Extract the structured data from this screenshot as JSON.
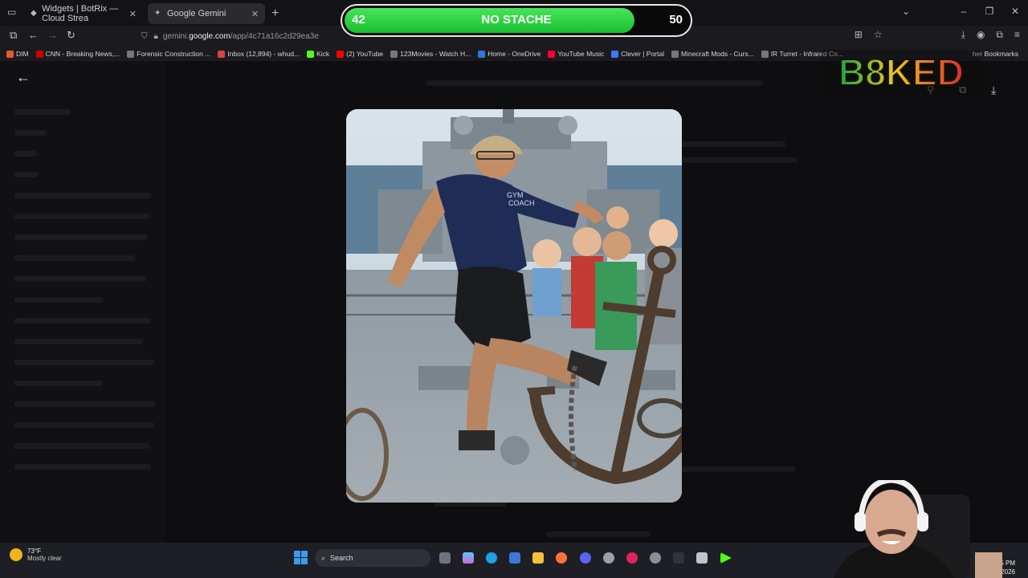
{
  "browser": {
    "tabs": [
      {
        "label": "Widgets | BotRix — Cloud Strea",
        "active": false
      },
      {
        "label": "Google Gemini",
        "active": true
      }
    ],
    "url_prefix": "gemini.",
    "url_domain": "google.com",
    "url_path": "/app/4c71a16c2d29ea3e",
    "bookmarks": [
      {
        "label": "DIM",
        "icon": "flame-icon",
        "color": "#e35a2a"
      },
      {
        "label": "CNN - Breaking News,...",
        "icon": "cnn-icon",
        "color": "#cc0000"
      },
      {
        "label": "Forensic Construction ...",
        "icon": "globe-icon",
        "color": "#777777"
      },
      {
        "label": "Inbox (12,894) - whud...",
        "icon": "mail-icon",
        "color": "#d44638"
      },
      {
        "label": "Kick",
        "icon": "kick-icon",
        "color": "#53fc18"
      },
      {
        "label": "(2) YouTube",
        "icon": "youtube-icon",
        "color": "#ff0000"
      },
      {
        "label": "123Movies - Watch H...",
        "icon": "globe-icon",
        "color": "#777777"
      },
      {
        "label": "Home - OneDrive",
        "icon": "onedrive-icon",
        "color": "#2b7cd3"
      },
      {
        "label": "YouTube Music",
        "icon": "music-icon",
        "color": "#ff0033"
      },
      {
        "label": "Clever | Portal",
        "icon": "clever-icon",
        "color": "#4274f6"
      },
      {
        "label": "Minecraft Mods - Curs...",
        "icon": "globe-icon",
        "color": "#777777"
      },
      {
        "label": "IR Turret - Infrared Co...",
        "icon": "globe-icon",
        "color": "#777777"
      }
    ],
    "other_bookmarks": "her Bookmarks"
  },
  "overlay": {
    "left_value": "42",
    "label": "NO STACHE",
    "right_value": "50",
    "progress": 0.84,
    "logo_text": "B8KED"
  },
  "taskbar": {
    "weather_temp": "73°F",
    "weather_desc": "Mostly clear",
    "search_label": "Search",
    "time": "9:25 PM",
    "date": "2/28/2026"
  },
  "image_viewer": {
    "shirt_text_1": "GYM",
    "shirt_text_2": "COACH"
  }
}
